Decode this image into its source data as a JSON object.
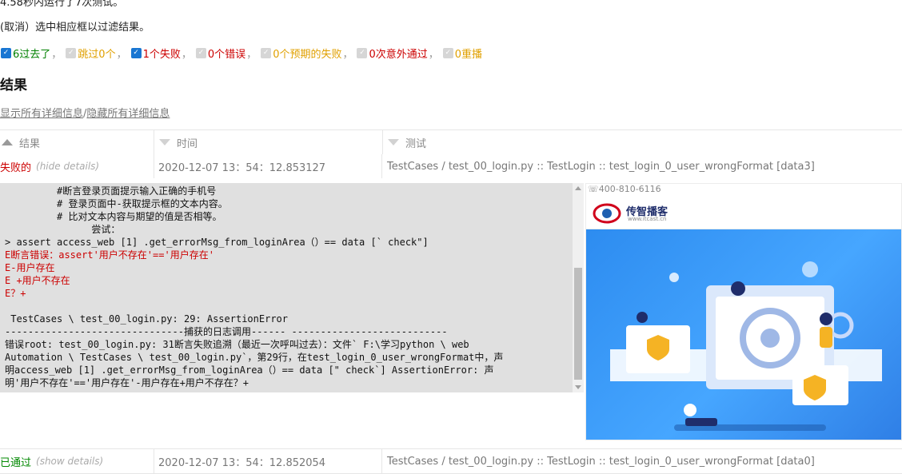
{
  "summary": {
    "line_partial": "4.58秒内运行了7次测试。",
    "filter_hint": "(取消）选中相应框以过滤结果。"
  },
  "filters": [
    {
      "label": "6过去了",
      "checked": true,
      "color": "#008000"
    },
    {
      "label": "跳过0个",
      "checked": false,
      "color": "#e0a000"
    },
    {
      "label": "1个失败",
      "checked": true,
      "color": "#cc0000"
    },
    {
      "label": "0个错误",
      "checked": false,
      "color": "#cc0000"
    },
    {
      "label": "0个预期的失败",
      "checked": false,
      "color": "#e0a000"
    },
    {
      "label": "0次意外通过",
      "checked": false,
      "color": "#cc0000"
    },
    {
      "label": "0重播",
      "checked": false,
      "color": "#e0a000"
    }
  ],
  "filter_separator": "，",
  "results": {
    "heading": "结果",
    "show_all": "显示所有详细信息",
    "slash": "/",
    "hide_all": "隐藏所有详细信息",
    "columns": {
      "result": "结果",
      "time": "时间",
      "test": "测试"
    },
    "rows": [
      {
        "result": "失败的",
        "toggle": "(hide details)",
        "time": "2020-12-07 13：54：12.853127",
        "test": "TestCases / test_00_login.py :: TestLogin :: test_login_0_user_wrongFormat [data3]"
      },
      {
        "result": "已通过",
        "toggle": "(show details)",
        "time": "2020-12-07 13：54：12.852054",
        "test": "TestCases / test_00_login.py :: TestLogin :: test_login_0_user_wrongFormat [data0]"
      }
    ]
  },
  "log_lines": [
    {
      "text": "         #断言登录页面提示输入正确的手机号",
      "error": false
    },
    {
      "text": "         # 登录页面中-获取提示框的文本内容。",
      "error": false
    },
    {
      "text": "         # 比对文本内容与期望的值是否相等。",
      "error": false
    },
    {
      "text": "               尝试：",
      "error": false
    },
    {
      "text": "> assert access_web [1] .get_errorMsg_from_loginArea（）== data [` check\"]",
      "error": false
    },
    {
      "text": "E断言错误：assert'用户不存在'=='用户存在'",
      "error": true
    },
    {
      "text": "E-用户存在",
      "error": true
    },
    {
      "text": "E +用户不存在",
      "error": true
    },
    {
      "text": "E？+",
      "error": true
    },
    {
      "text": "",
      "error": false
    },
    {
      "text": " TestCases \\ test_00_login.py: 29: AssertionError",
      "error": false
    },
    {
      "text": "-------------------------------捕获的日志调用------ ---------------------------",
      "error": false
    },
    {
      "text": "错误root: test_00_login.py: 31断言失败追溯（最近一次呼叫过去）：文件` F:\\学习python \\ web",
      "error": false
    },
    {
      "text": "Automation \\ TestCases \\ test_00_login.py`，第29行，在test_login_0_user_wrongFormat中，声",
      "error": false
    },
    {
      "text": "明access_web [1] .get_errorMsg_from_loginArea（）== data [\" check`] AssertionError: 声",
      "error": false
    },
    {
      "text": "明'用户不存在'=='用户存在'-用户存在+用户不存在？+",
      "error": false
    }
  ],
  "screenshot": {
    "phone": "☏400-810-6116",
    "brand": "传智播客",
    "brand_sub": "www.itcast.cn",
    "colors": {
      "hero": "#2d8cf0",
      "brand": "#1f2d6b",
      "accent": "#f5b324"
    }
  }
}
